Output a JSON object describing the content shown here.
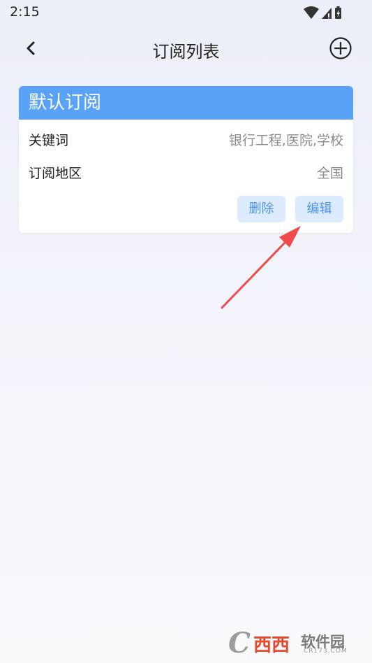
{
  "status_bar": {
    "time": "2:15"
  },
  "nav": {
    "title": "订阅列表"
  },
  "card": {
    "title": "默认订阅",
    "keyword_label": "关键词",
    "keyword_value": "银行工程,医院,学校",
    "region_label": "订阅地区",
    "region_value": "全国",
    "delete_label": "删除",
    "edit_label": "编辑"
  },
  "watermark": {
    "logo_text": "西西软件园",
    "url": "CR173.COM"
  },
  "colors": {
    "header_blue": "#5aa2f8",
    "button_bg": "#dcebfd",
    "button_text": "#4e93ea",
    "arrow_red": "#f04b4b"
  }
}
